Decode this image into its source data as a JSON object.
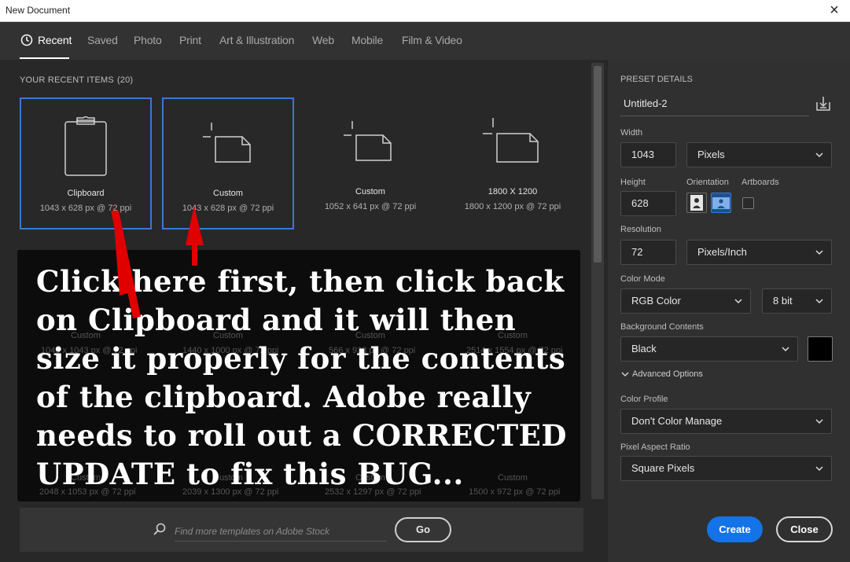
{
  "window": {
    "title": "New Document",
    "close_glyph": "×"
  },
  "tabs": [
    {
      "label": "Recent",
      "active": true
    },
    {
      "label": "Saved"
    },
    {
      "label": "Photo"
    },
    {
      "label": "Print"
    },
    {
      "label": "Art & Illustration"
    },
    {
      "label": "Web"
    },
    {
      "label": "Mobile"
    },
    {
      "label": "Film & Video"
    }
  ],
  "recent": {
    "heading": "YOUR RECENT ITEMS",
    "count": "(20)",
    "items": [
      {
        "name": "Clipboard",
        "meta": "1043 x 628 px @ 72 ppi",
        "icon": "clipboard-icon",
        "selected": true
      },
      {
        "name": "Custom",
        "meta": "1043 x 628 px @ 72 ppi",
        "icon": "custom-document-icon",
        "selected": true
      },
      {
        "name": "Custom",
        "meta": "1052 x 641 px @ 72 ppi",
        "icon": "custom-document-icon",
        "selected": false
      },
      {
        "name": "1800 X 1200",
        "meta": "1800 x 1200 px @ 72 ppi",
        "icon": "custom-document-icon",
        "selected": false
      }
    ],
    "hidden_row": [
      {
        "name": "Custom",
        "meta": "1043 x 1043 px @ 72 ppi"
      },
      {
        "name": "Custom",
        "meta": "1440 x 1000 px @ 72 ppi"
      },
      {
        "name": "Custom",
        "meta": "566 x 938 px @ 72 ppi"
      },
      {
        "name": "Custom",
        "meta": "2514 x 1554 px @ 72 ppi"
      }
    ],
    "hidden_row_2": [
      {
        "name": "Custom",
        "meta": "2048 x 1053 px @ 72 ppi"
      },
      {
        "name": "Custom",
        "meta": "2039 x 1300 px @ 72 ppi"
      },
      {
        "name": "Custom",
        "meta": "2532 x 1297 px @ 72 ppi"
      },
      {
        "name": "Custom",
        "meta": "1500 x 972 px @ 72 ppi"
      }
    ]
  },
  "annotation": {
    "text": "Click here first, then click back on Clipboard and it will then size it properly for the contents of the clipboard. Adobe really needs to roll out a CORRECTED UPDATE to fix this BUG...",
    "arrow_color": "#e00000"
  },
  "search": {
    "placeholder": "Find more templates on Adobe Stock",
    "go_label": "Go"
  },
  "preset": {
    "heading": "PRESET DETAILS",
    "doc_name": "Untitled-2",
    "width_label": "Width",
    "width_value": "1043",
    "width_unit": "Pixels",
    "height_label": "Height",
    "height_value": "628",
    "orientation_label": "Orientation",
    "artboards_label": "Artboards",
    "resolution_label": "Resolution",
    "resolution_value": "72",
    "resolution_unit": "Pixels/Inch",
    "color_mode_label": "Color Mode",
    "color_mode_value": "RGB Color",
    "bit_depth": "8 bit",
    "background_label": "Background Contents",
    "background_value": "Black",
    "background_swatch": "#000000",
    "advanced_label": "Advanced Options",
    "color_profile_label": "Color Profile",
    "color_profile_value": "Don't Color Manage",
    "pixel_aspect_label": "Pixel Aspect Ratio",
    "pixel_aspect_value": "Square Pixels"
  },
  "actions": {
    "create_label": "Create",
    "close_label": "Close"
  },
  "colors": {
    "accent": "#1473e6",
    "selection": "#3b78d1"
  }
}
